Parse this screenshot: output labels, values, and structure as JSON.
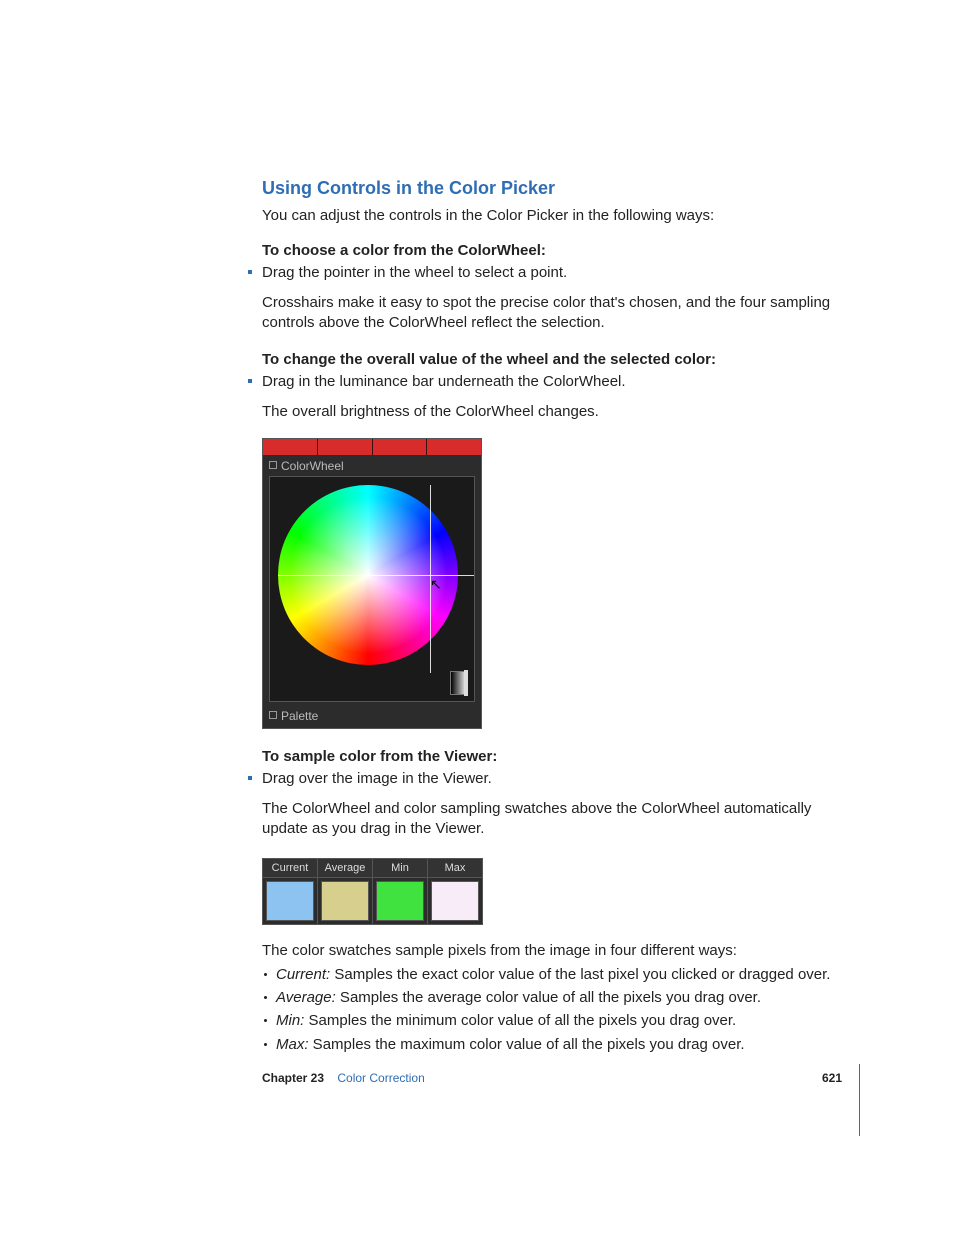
{
  "heading": "Using Controls in the Color Picker",
  "intro": "You can adjust the controls in the Color Picker in the following ways:",
  "section1": {
    "lead": "To choose a color from the ColorWheel:",
    "bullet": "Drag the pointer in the wheel to select a point.",
    "follow": "Crosshairs make it easy to spot the precise color that's chosen, and the four sampling controls above the ColorWheel reflect the selection."
  },
  "section2": {
    "lead": "To change the overall value of the wheel and the selected color:",
    "bullet": "Drag in the luminance bar underneath the ColorWheel.",
    "follow": "The overall brightness of the ColorWheel changes."
  },
  "cw_panel": {
    "title": "ColorWheel",
    "footer": "Palette"
  },
  "section3": {
    "lead": "To sample color from the Viewer:",
    "bullet": "Drag over the image in the Viewer.",
    "follow": "The ColorWheel and color sampling swatches above the ColorWheel automatically update as you drag in the Viewer."
  },
  "swatches": [
    {
      "label": "Current",
      "color": "#8cc3f0"
    },
    {
      "label": "Average",
      "color": "#d6cf8e"
    },
    {
      "label": "Min",
      "color": "#3fe23f"
    },
    {
      "label": "Max",
      "color": "#f7ecf7"
    }
  ],
  "swatch_intro": "The color swatches sample pixels from the image in four different ways:",
  "defs": [
    {
      "term": "Current:",
      "desc": "  Samples the exact color value of the last pixel you clicked or dragged over."
    },
    {
      "term": "Average:",
      "desc": "  Samples the average color value of all the pixels you drag over."
    },
    {
      "term": "Min:",
      "desc": "  Samples the minimum color value of all the pixels you drag over."
    },
    {
      "term": "Max:",
      "desc": "  Samples the maximum color value of all the pixels you drag over."
    }
  ],
  "footer": {
    "chapter": "Chapter 23",
    "title": "Color Correction",
    "page": "621"
  }
}
